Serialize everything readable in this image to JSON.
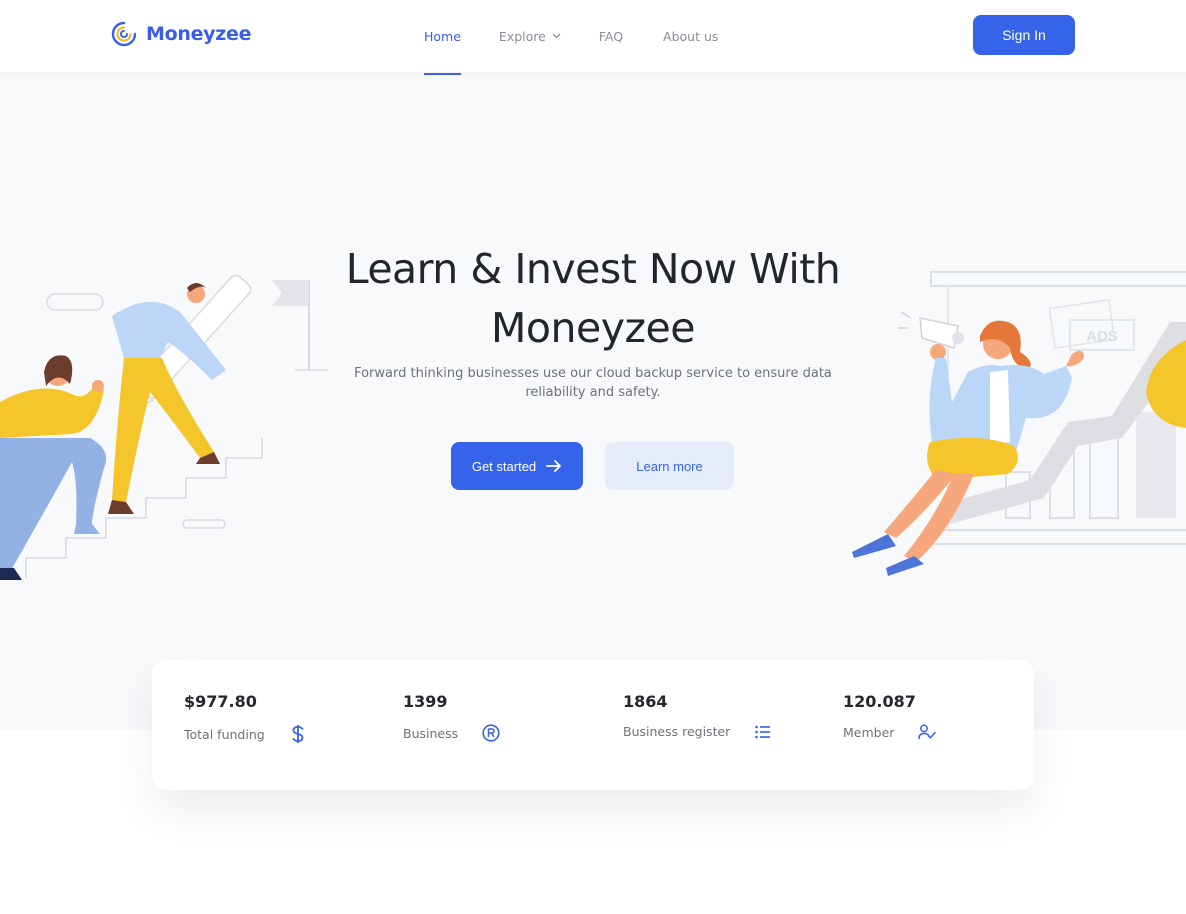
{
  "brand": {
    "name": "Moneyzee",
    "color": "#3563e9"
  },
  "nav": {
    "home": "Home",
    "explore": "Explore",
    "faq": "FAQ",
    "about": "About us"
  },
  "header": {
    "signin_label": "Sign In"
  },
  "hero": {
    "title_line1": "Learn & Invest Now With",
    "title_line2": "Moneyzee",
    "subtitle_line1": "Forward thinking businesses use our cloud backup service to ensure data",
    "subtitle_line2": "reliability and safety.",
    "primary_button": "Get started",
    "secondary_button": "Learn more",
    "ads_label": "ADS"
  },
  "stats": [
    {
      "value": "$977.80",
      "label": "Total funding",
      "icon": "dollar-icon"
    },
    {
      "value": "1399",
      "label": "Business",
      "icon": "registered-icon"
    },
    {
      "value": "1864",
      "label": "Business register",
      "icon": "list-icon"
    },
    {
      "value": "120.087",
      "label": "Member",
      "icon": "user-check-icon"
    }
  ]
}
